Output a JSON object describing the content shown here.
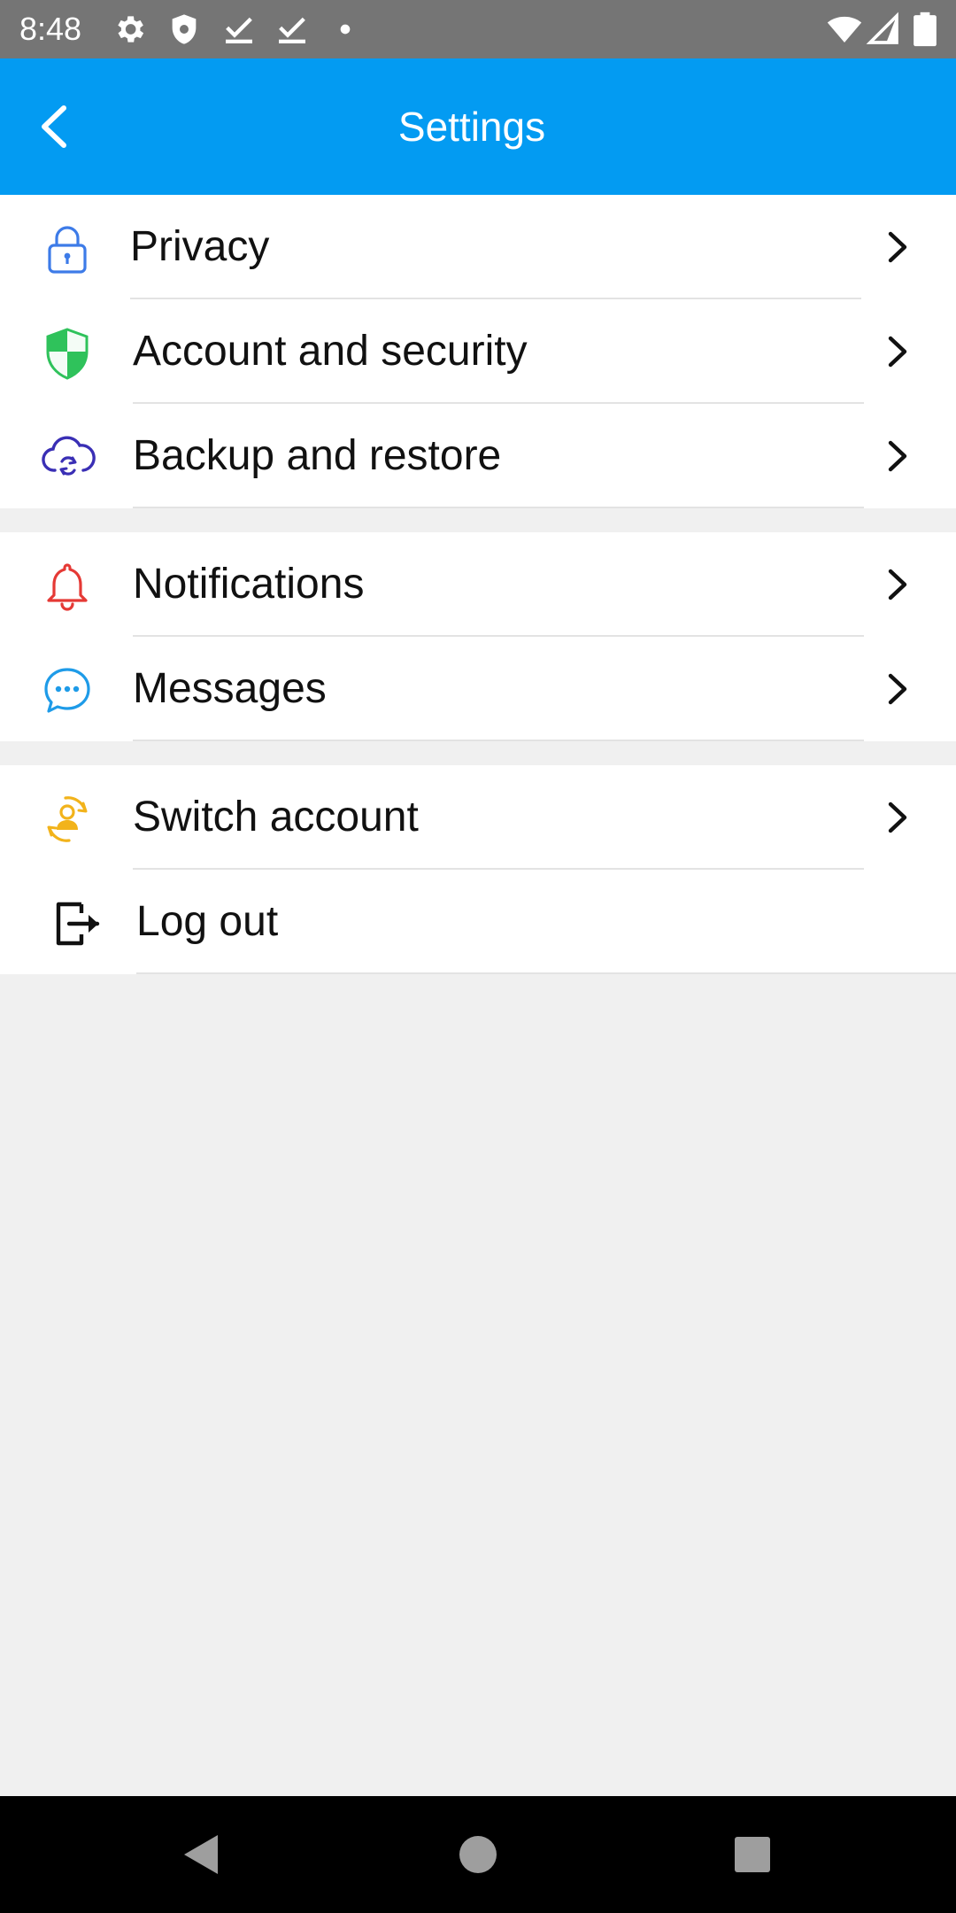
{
  "status_bar": {
    "time": "8:48",
    "icons": [
      "gear-icon",
      "shield-icon",
      "check-icon",
      "check-icon",
      "dot-icon",
      "wifi-icon",
      "signal-icon",
      "battery-icon"
    ]
  },
  "app_bar": {
    "title": "Settings",
    "back_icon": "chevron-left-icon"
  },
  "groups": [
    {
      "items": [
        {
          "label": "Privacy",
          "icon": "lock-icon",
          "color": "#3d7be8",
          "chevron": true
        },
        {
          "label": "Account and security",
          "icon": "shield-icon",
          "color": "#2fc25b",
          "chevron": true
        },
        {
          "label": "Backup and restore",
          "icon": "cloud-sync-icon",
          "color": "#3a2fb5",
          "chevron": true
        }
      ]
    },
    {
      "items": [
        {
          "label": "Notifications",
          "icon": "bell-icon",
          "color": "#e53935",
          "chevron": true
        },
        {
          "label": "Messages",
          "icon": "chat-bubble-icon",
          "color": "#1e9be8",
          "chevron": true
        }
      ]
    },
    {
      "items": [
        {
          "label": "Switch account",
          "icon": "switch-account-icon",
          "color": "#f2b31b",
          "chevron": true
        },
        {
          "label": "Log out",
          "icon": "logout-icon",
          "color": "#111111",
          "chevron": false
        }
      ]
    }
  ],
  "colors": {
    "app_bar": "#039bf2",
    "status_bar": "#757575",
    "background": "#f0f0f0"
  },
  "nav_bar": {
    "buttons": [
      "back-triangle-icon",
      "home-circle-icon",
      "recents-square-icon"
    ]
  }
}
